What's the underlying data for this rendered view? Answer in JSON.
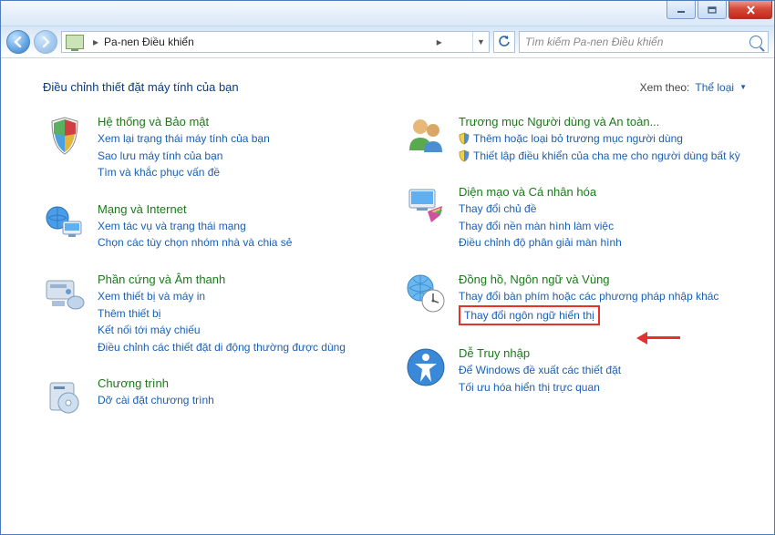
{
  "breadcrumb": {
    "location": "Pa-nen Điều khiển"
  },
  "search": {
    "placeholder": "Tìm kiếm Pa-nen Điều khiển"
  },
  "main": {
    "title": "Điều chỉnh thiết đặt máy tính của bạn",
    "view_by_label": "Xem theo:",
    "view_by_value": "Thể loại"
  },
  "categories": {
    "system": {
      "title": "Hệ thống và Bảo mật",
      "l1": "Xem lại trạng thái máy tính của bạn",
      "l2": "Sao lưu máy tính của bạn",
      "l3": "Tìm và khắc phục vấn đề"
    },
    "network": {
      "title": "Mạng và Internet",
      "l1": "Xem tác vụ và trạng thái mạng",
      "l2": "Chọn các tùy chọn nhóm nhà và chia sẻ"
    },
    "hardware": {
      "title": "Phần cứng và Âm thanh",
      "l1": "Xem thiết bị và máy in",
      "l2": "Thêm thiết bị",
      "l3": "Kết nối tới máy chiếu",
      "l4": "Điều chỉnh các thiết đặt di động thường được dùng"
    },
    "programs": {
      "title": "Chương trình",
      "l1": "Dỡ cài đặt chương trình"
    },
    "users": {
      "title": "Trương mục Người dùng và An toàn...",
      "l1": "Thêm hoặc loại bỏ trương mục người dùng",
      "l2": "Thiết lập điều khiển của cha mẹ cho người dùng bất kỳ"
    },
    "appearance": {
      "title": "Diện mạo và Cá nhân hóa",
      "l1": "Thay đổi chủ đề",
      "l2": "Thay đổi nền màn hình làm việc",
      "l3": "Điều chỉnh độ phân giải màn hình"
    },
    "clock": {
      "title": "Đồng hồ, Ngôn ngữ và Vùng",
      "l1": "Thay đổi bàn phím hoặc các phương pháp nhập khác",
      "l2": "Thay đổi ngôn ngữ hiển thị"
    },
    "ease": {
      "title": "Dễ Truy nhập",
      "l1": "Để Windows đề xuất các thiết đặt",
      "l2": "Tối ưu hóa hiển thị trực quan"
    }
  }
}
